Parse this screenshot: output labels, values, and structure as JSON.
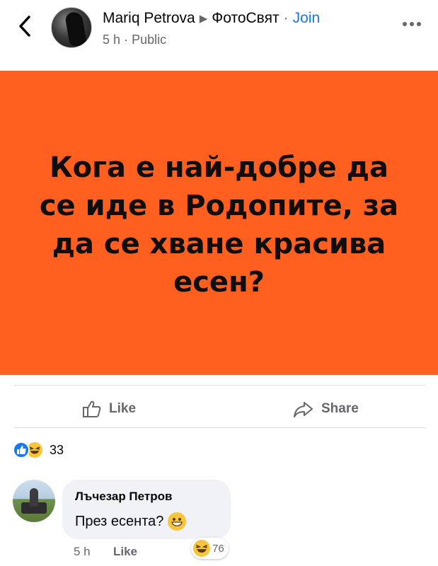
{
  "header": {
    "author": "Mariq Petrova",
    "group": "ФотоСвят",
    "separator": "·",
    "join_label": "Join",
    "time": "5 h",
    "visibility": "Public"
  },
  "post": {
    "text": "Кога е най-добре да се иде в Родопите, за да се хване красива есен?",
    "background_color": "#ff5f1f"
  },
  "actions": {
    "like_label": "Like",
    "share_label": "Share"
  },
  "reactions": {
    "types": [
      "like",
      "haha"
    ],
    "count": "33"
  },
  "comment": {
    "author": "Лъчезар Петров",
    "text": "През есента?",
    "time": "5 h",
    "like_label": "Like",
    "reaction_type": "haha",
    "reaction_count": "76"
  },
  "colors": {
    "accent": "#1877f2",
    "muted": "#65676b",
    "bubble": "#f0f2f5"
  }
}
